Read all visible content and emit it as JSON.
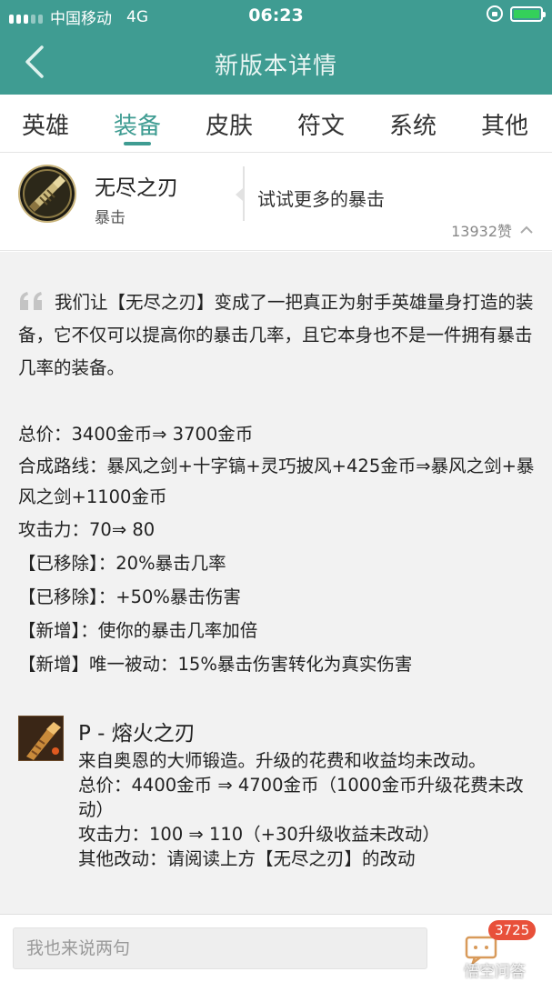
{
  "status_bar": {
    "carrier": "中国移动",
    "network": "4G",
    "time": "06:23",
    "battery_color": "#34d05a"
  },
  "nav": {
    "title": "新版本详情",
    "back_icon": "chevron-left-icon",
    "bar_color": "#3f9c92"
  },
  "tabs": [
    {
      "label": "英雄",
      "active": false
    },
    {
      "label": "装备",
      "active": true
    },
    {
      "label": "皮肤",
      "active": false
    },
    {
      "label": "符文",
      "active": false
    },
    {
      "label": "系统",
      "active": false
    },
    {
      "label": "其他",
      "active": false
    }
  ],
  "item": {
    "name": "无尽之刃",
    "category": "暴击",
    "tip": "试试更多的暴击",
    "likes": "13932赞"
  },
  "content": {
    "quote": "我们让【无尽之刃】变成了一把真正为射手英雄量身打造的装备，它不仅可以提高你的暴击几率，且它本身也不是一件拥有暴击几率的装备。",
    "lines": [
      "总价：3400金币⇒ 3700金币",
      "合成路线：暴风之剑+十字镐+灵巧披风+425金币⇒暴风之剑+暴风之剑+1100金币",
      "攻击力：70⇒ 80",
      "【已移除】：20%暴击几率",
      "【已移除】：+50%暴击伤害",
      "【新增】：使你的暴击几率加倍",
      "【新增】唯一被动：15%暴击伤害转化为真实伤害"
    ],
    "sub_item": {
      "title": "P - 熔火之刃",
      "lines": [
        "来自奥恩的大师锻造。升级的花费和收益均未改动。",
        "总价：4400金币 ⇒ 4700金币（1000金币升级花费未改动）",
        "攻击力：100 ⇒ 110（+30升级收益未改动）",
        "其他改动：请阅读上方【无尽之刃】的改动"
      ]
    }
  },
  "footer": {
    "comment_placeholder": "我也来说两句",
    "comment_count": "3725",
    "badge_color": "#e8503a",
    "watermark": "悟空问答"
  }
}
